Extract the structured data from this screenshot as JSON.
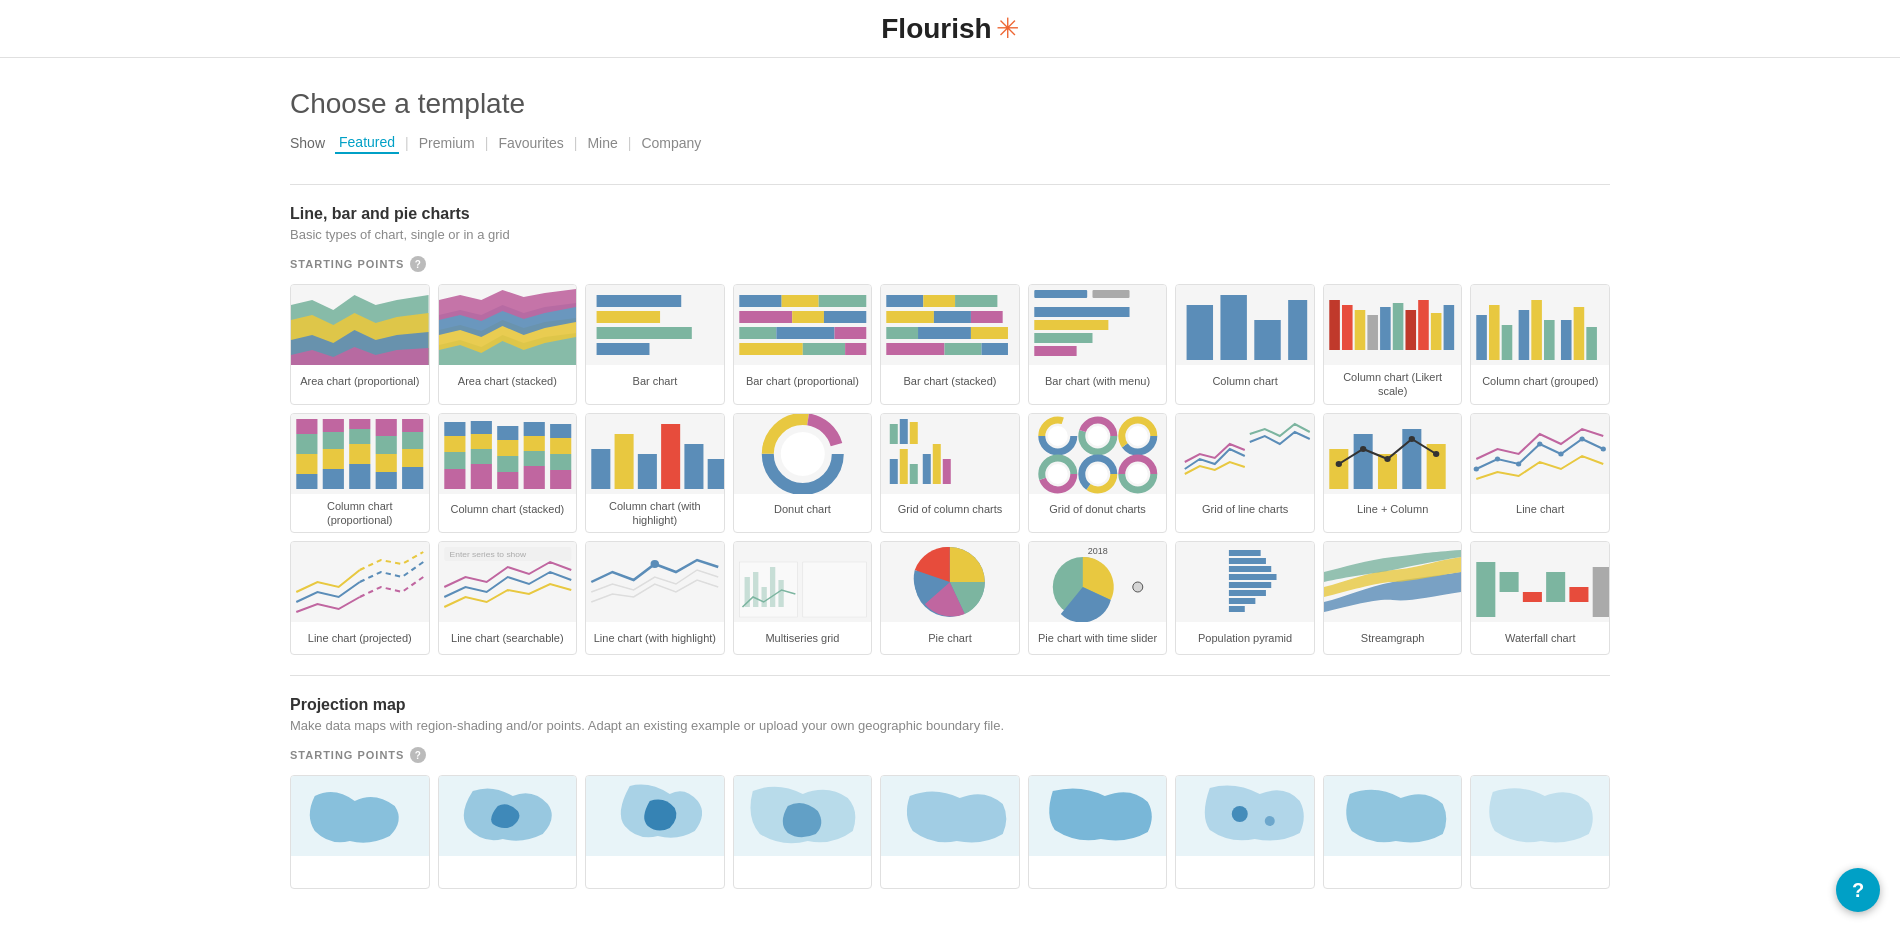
{
  "header": {
    "logo_text": "Flourish",
    "logo_asterisk": "✳"
  },
  "page": {
    "title": "Choose a template",
    "show_label": "Show",
    "nav_links": [
      {
        "label": "Featured",
        "active": true
      },
      {
        "label": "Premium",
        "active": false
      },
      {
        "label": "Favourites",
        "active": false
      },
      {
        "label": "Mine",
        "active": false
      },
      {
        "label": "Company",
        "active": false
      }
    ]
  },
  "sections": [
    {
      "id": "line-bar-pie",
      "title": "Line, bar and pie charts",
      "description": "Basic types of chart, single or in a grid",
      "starting_points_label": "STARTING POINTS",
      "templates": [
        {
          "label": "Area chart (proportional)",
          "type": "area-proportional"
        },
        {
          "label": "Area chart (stacked)",
          "type": "area-stacked"
        },
        {
          "label": "Bar chart",
          "type": "bar"
        },
        {
          "label": "Bar chart (proportional)",
          "type": "bar-proportional"
        },
        {
          "label": "Bar chart (stacked)",
          "type": "bar-stacked"
        },
        {
          "label": "Bar chart (with menu)",
          "type": "bar-menu"
        },
        {
          "label": "Column chart",
          "type": "column"
        },
        {
          "label": "Column chart (Likert scale)",
          "type": "column-likert"
        },
        {
          "label": "Column chart (grouped)",
          "type": "column-grouped"
        },
        {
          "label": "Column chart (proportional)",
          "type": "column-proportional"
        },
        {
          "label": "Column chart (stacked)",
          "type": "column-stacked"
        },
        {
          "label": "Column chart (with highlight)",
          "type": "column-highlight"
        },
        {
          "label": "Donut chart",
          "type": "donut"
        },
        {
          "label": "Grid of column charts",
          "type": "grid-column"
        },
        {
          "label": "Grid of donut charts",
          "type": "grid-donut"
        },
        {
          "label": "Grid of line charts",
          "type": "grid-line"
        },
        {
          "label": "Line + Column",
          "type": "line-column"
        },
        {
          "label": "Line chart",
          "type": "line"
        },
        {
          "label": "Line chart (projected)",
          "type": "line-projected"
        },
        {
          "label": "Line chart (searchable)",
          "type": "line-searchable"
        },
        {
          "label": "Line chart (with highlight)",
          "type": "line-highlight"
        },
        {
          "label": "Multiseries grid",
          "type": "multiseries"
        },
        {
          "label": "Pie chart",
          "type": "pie"
        },
        {
          "label": "Pie chart with time slider",
          "type": "pie-time"
        },
        {
          "label": "Population pyramid",
          "type": "population"
        },
        {
          "label": "Streamgraph",
          "type": "streamgraph"
        },
        {
          "label": "Waterfall chart",
          "type": "waterfall"
        }
      ]
    },
    {
      "id": "projection-map",
      "title": "Projection map",
      "description": "Make data maps with region-shading and/or points. Adapt an existing example or upload your own geographic boundary file.",
      "starting_points_label": "STARTING POINTS",
      "templates": [
        {
          "label": "",
          "type": "map1"
        },
        {
          "label": "",
          "type": "map2"
        },
        {
          "label": "",
          "type": "map3"
        },
        {
          "label": "",
          "type": "map4"
        },
        {
          "label": "",
          "type": "map5"
        },
        {
          "label": "",
          "type": "map6"
        },
        {
          "label": "",
          "type": "map7"
        },
        {
          "label": "",
          "type": "map8"
        },
        {
          "label": "",
          "type": "map9"
        }
      ]
    }
  ],
  "help_label": "?"
}
